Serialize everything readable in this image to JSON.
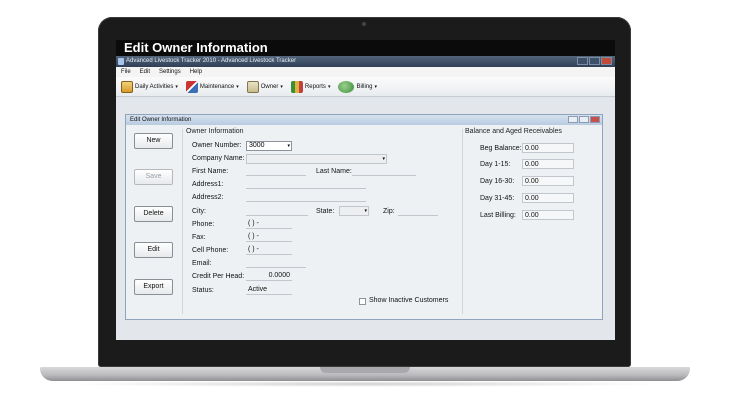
{
  "banner": {
    "title": "Edit Owner Information"
  },
  "app": {
    "title": "Advanced Livestock Tracker 2010 - Advanced Livestock Tracker"
  },
  "menu": [
    "File",
    "Edit",
    "Settings",
    "Help"
  ],
  "toolbar": {
    "daily": "Daily Activities",
    "maintenance": "Maintenance",
    "owner": "Owner",
    "reports": "Reports",
    "billing": "Billing",
    "arrow": "▾"
  },
  "child": {
    "title": "Edit Owner Information",
    "buttons": {
      "new": "New",
      "save": "Save",
      "delete": "Delete",
      "edit": "Edit",
      "export": "Export"
    },
    "owner_group": {
      "heading": "Owner Information",
      "owner_number_label": "Owner Number:",
      "owner_number_value": "3000",
      "company_name_label": "Company Name:",
      "first_name_label": "First Name:",
      "last_name_label": "Last Name:",
      "address1_label": "Address1:",
      "address2_label": "Address2:",
      "city_label": "City:",
      "state_label": "State:",
      "zip_label": "Zip:",
      "phone_label": "Phone:",
      "phone_value": "(   )   -",
      "fax_label": "Fax:",
      "fax_value": "(   )   -",
      "cell_label": "Cell Phone:",
      "cell_value": "(   )   -",
      "email_label": "Email:",
      "credit_label": "Credit Per Head:",
      "credit_value": "0.0000",
      "status_label": "Status:",
      "status_value": "Active",
      "show_inactive_label": "Show Inactive Customers"
    },
    "balance_group": {
      "heading": "Balance and Aged Receivables",
      "rows": [
        {
          "label": "Beg Balance:",
          "value": "0.00"
        },
        {
          "label": "Day 1-15:",
          "value": "0.00"
        },
        {
          "label": "Day 16-30:",
          "value": "0.00"
        },
        {
          "label": "Day 31-45:",
          "value": "0.00"
        },
        {
          "label": "Last Billing:",
          "value": "0.00"
        }
      ]
    }
  }
}
